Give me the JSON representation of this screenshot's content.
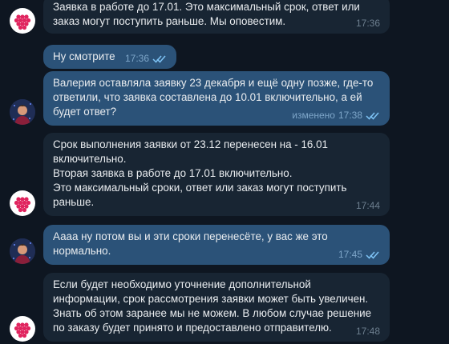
{
  "messages": [
    {
      "id": "m1",
      "sender": "support",
      "lines": [
        "Заявка в работе до 17.01. Это максимальный срок, ответ или",
        "заказ могут поступить раньше. Мы оповестим."
      ],
      "time": "17:36"
    },
    {
      "id": "m2",
      "sender": "me",
      "lines": [
        "Ну смотрите"
      ],
      "time": "17:36",
      "status": "read"
    },
    {
      "id": "m3",
      "sender": "me",
      "lines": [
        "Валерия оставляла заявку 23 декабря и ещё одну позже, где-то",
        "ответили, что заявка составлена до 10.01 включительно, а ей",
        "будет ответ?"
      ],
      "edited_label": "изменено",
      "time": "17:38",
      "status": "read"
    },
    {
      "id": "m4",
      "sender": "support",
      "lines": [
        "Срок выполнения заявки от 23.12 перенесен на - 16.01",
        "включительно.",
        "Вторая заявка в работе до 17.01 включительно.",
        "Это максимальный сроки, ответ или заказ могут поступить",
        "раньше."
      ],
      "time": "17:44"
    },
    {
      "id": "m5",
      "sender": "me",
      "lines": [
        "Аааа ну потом вы и эти сроки перенесёте, у вас же это",
        "нормально."
      ],
      "time": "17:45",
      "status": "read"
    },
    {
      "id": "m6",
      "sender": "support",
      "lines": [
        "Если будет необходимо уточнение дополнительной",
        "информации, срок рассмотрения заявки может быть увеличен.",
        "Знать об этом заранее мы не можем. В любом случае решение",
        "по заказу будет принято и предоставлено отправителю."
      ],
      "time": "17:48"
    }
  ],
  "colors": {
    "background": "#0e1621",
    "incoming_bubble": "#182533",
    "outgoing_bubble": "#2b5278",
    "brand_red": "#e0245e"
  },
  "icons": {
    "support_avatar": "raspberry-dots-logo",
    "user_avatar": "photo-avatar",
    "read_status": "double-check-icon"
  }
}
